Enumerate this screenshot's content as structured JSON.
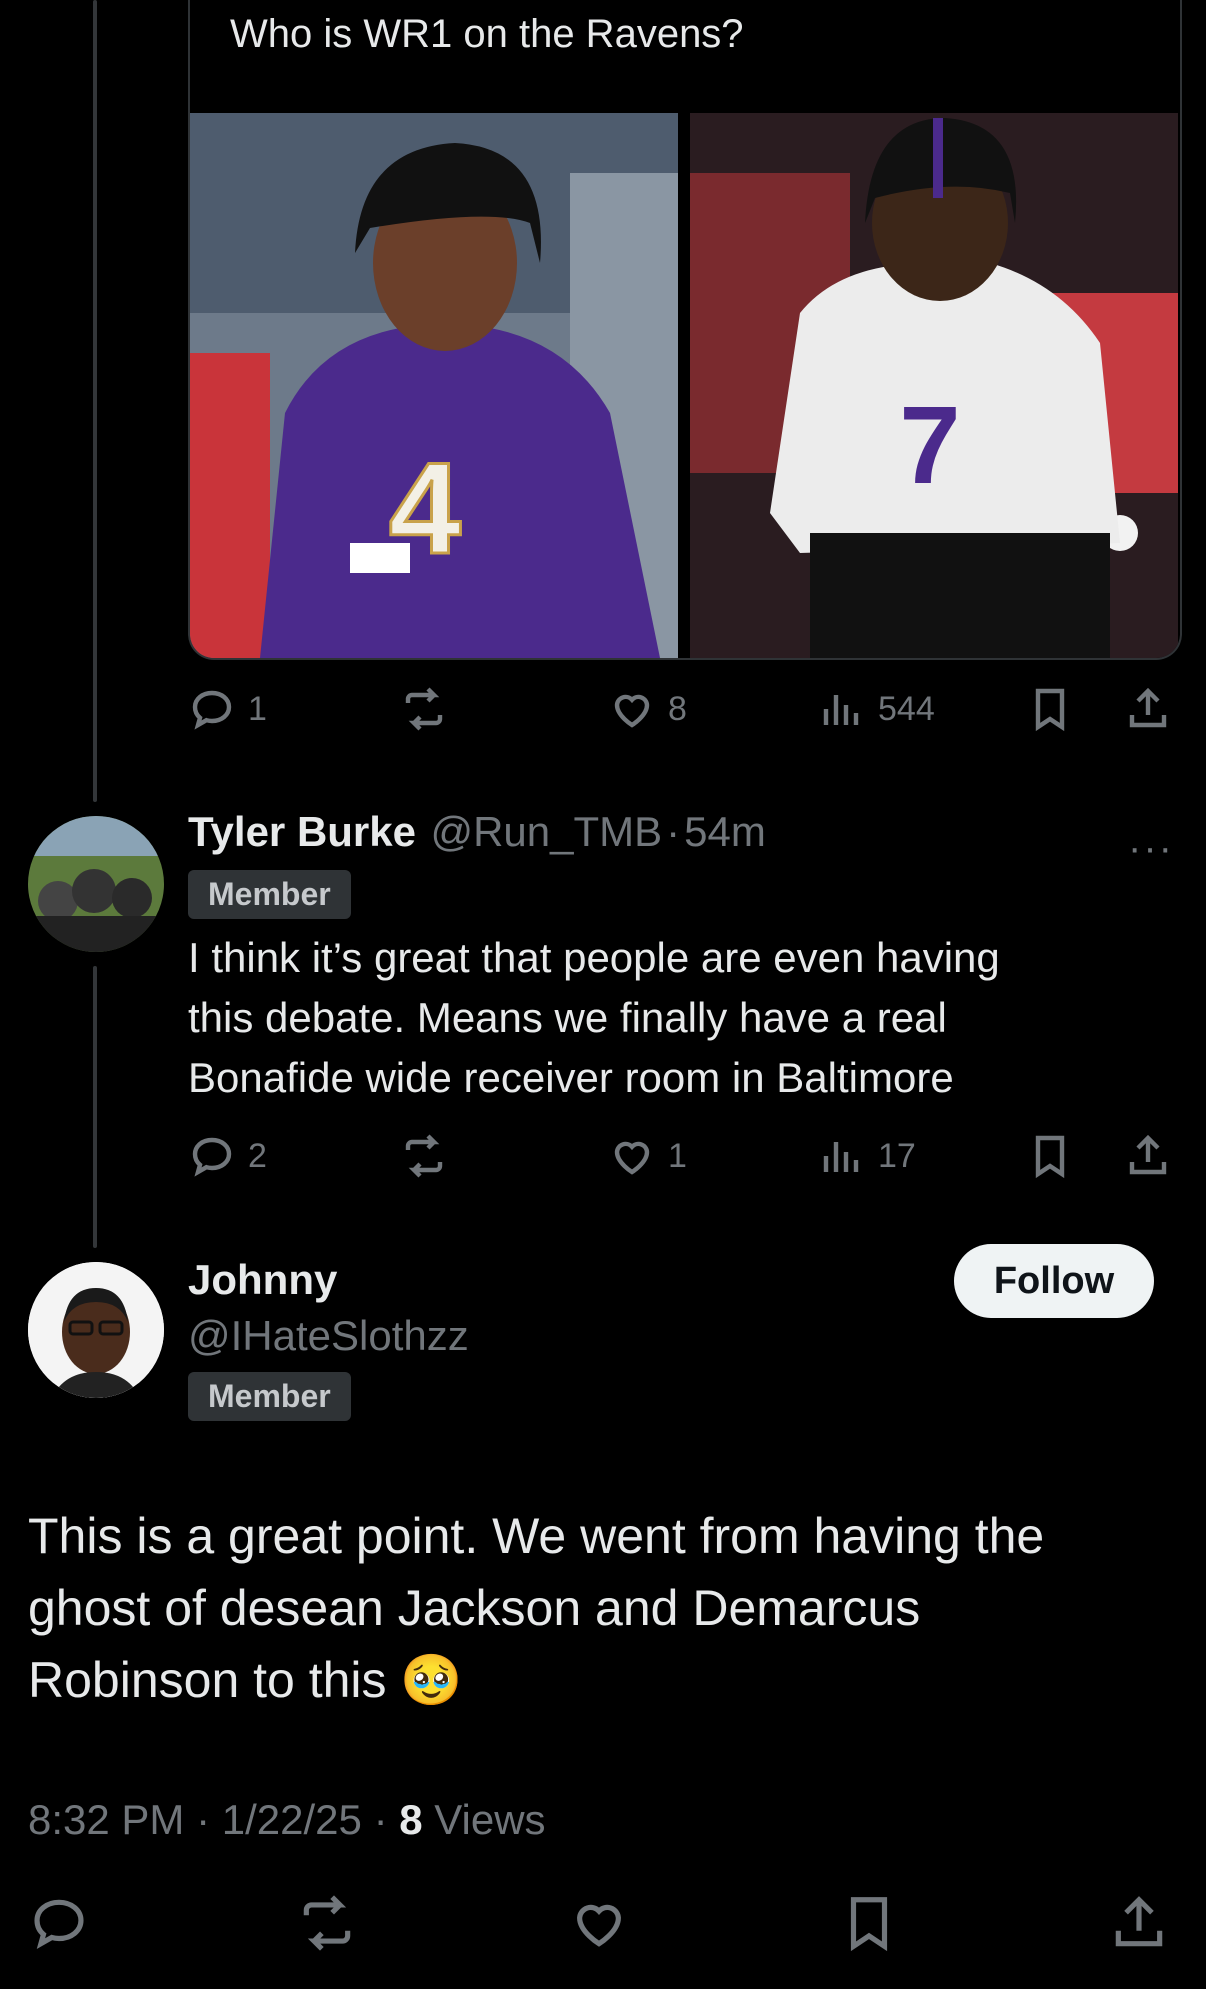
{
  "quoted_post": {
    "text": "Who is WR1 on the Ravens?",
    "images": [
      "player-4-purple-jersey",
      "player-7-white-jersey"
    ],
    "actions": {
      "replies": "1",
      "likes": "8",
      "views": "544"
    }
  },
  "reply": {
    "name": "Tyler Burke",
    "handle": "@Run_TMB",
    "sep": "·",
    "time": "54m",
    "badge": "Member",
    "text_lines": [
      "I think it’s great that people are even having",
      "this debate. Means we finally have a real",
      "Bonafide wide receiver room in Baltimore"
    ],
    "actions": {
      "replies": "2",
      "likes": "1",
      "views": "17"
    },
    "more": "···"
  },
  "main_post": {
    "name": "Johnny",
    "handle": "@IHateSlothzz",
    "badge": "Member",
    "follow_label": "Follow",
    "text_lines": [
      "This is a great point. We went from having the",
      "ghost of desean Jackson and Demarcus",
      "Robinson to this 🥹"
    ],
    "time": "8:32 PM",
    "date": "1/22/25",
    "views_count": "8",
    "views_label": "Views",
    "sep": "·"
  },
  "icons": [
    "reply-icon",
    "repost-icon",
    "like-icon",
    "views-icon",
    "bookmark-icon",
    "share-icon"
  ],
  "colors": {
    "background": "#000000",
    "text": "#e7e9ea",
    "muted": "#71767b",
    "jersey_purple": "#4b2a8c"
  }
}
